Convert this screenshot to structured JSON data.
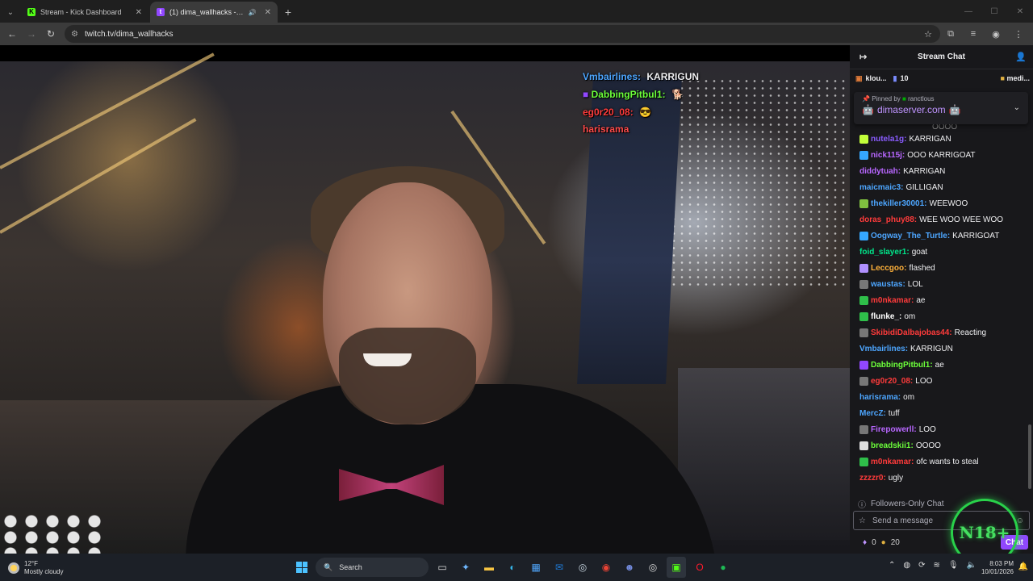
{
  "browser": {
    "tabs": [
      {
        "title": "Stream - Kick Dashboard",
        "active": false,
        "favicon": "kick-icon",
        "favicon_color": "#53fc18"
      },
      {
        "title": "(1) dima_wallhacks - Twitch",
        "active": true,
        "favicon": "twitch-icon",
        "favicon_color": "#9147ff"
      }
    ],
    "url": "twitch.tv/dima_wallhacks"
  },
  "overlay_chat": [
    {
      "user": "Vmbairlines:",
      "text": "KARRIGUN",
      "color": "#4da6ff"
    },
    {
      "user": "DabbingPitbul1:",
      "text": "",
      "color": "#6cff3a"
    },
    {
      "user": "eg0r20_08:",
      "text": "",
      "color": "#ff3b3b"
    },
    {
      "user": "harisrama",
      "text": "",
      "color": "#ff4a4a"
    }
  ],
  "chat": {
    "title": "Stream Chat",
    "leaderboard": {
      "user": "klou...",
      "count": "10",
      "right": "medi..."
    },
    "pinned": {
      "by_label": "Pinned by",
      "by_user": "ranctlous",
      "message": "dimaserver.com"
    },
    "partial_top": "OOOO",
    "messages": [
      {
        "user": "nutela1g:",
        "text": "KARRIGAN",
        "color": "#8a5cff",
        "badge": "#c3ff3a"
      },
      {
        "user": "nick115j:",
        "text": "OOO KARRIGOAT",
        "color": "#b867ff",
        "badge": "#35a7ff"
      },
      {
        "user": "diddytuah:",
        "text": "KARRIGAN",
        "color": "#b866ff",
        "badge": ""
      },
      {
        "user": "maicmaic3:",
        "text": "GILLIGAN",
        "color": "#4da6ff",
        "badge": ""
      },
      {
        "user": "thekiller30001:",
        "text": "WEEWOO",
        "color": "#4da6ff",
        "badge": "#7fbf3f"
      },
      {
        "user": "doras_phuy88:",
        "text": "WEE WOO WEE WOO",
        "color": "#ff3b3b",
        "badge": ""
      },
      {
        "user": "Oogway_The_Turtle:",
        "text": "KARRIGOAT",
        "color": "#4da6ff",
        "badge": "#35a7ff"
      },
      {
        "user": "foid_slayer1:",
        "text": "goat",
        "color": "#00e68a",
        "badge": ""
      },
      {
        "user": "Leccgoo:",
        "text": "flashed",
        "color": "#ffb13a",
        "badge": "#b090ff"
      },
      {
        "user": "waustas:",
        "text": "LOL",
        "color": "#4da6ff",
        "badge": "#777"
      },
      {
        "user": "m0nkamar:",
        "text": "ae",
        "color": "#ff3b3b",
        "badge": "#2fbf4a"
      },
      {
        "user": "flunke_:",
        "text": "om",
        "color": "#ffffff",
        "badge": "#2fbf4a"
      },
      {
        "user": "SkibidiDalbajobas44:",
        "text": "Reacting",
        "color": "#ff3b3b",
        "badge": "#777"
      },
      {
        "user": "Vmbairlines:",
        "text": "KARRIGUN",
        "color": "#4da6ff",
        "badge": ""
      },
      {
        "user": "DabbingPitbul1:",
        "text": "ae",
        "color": "#6cff3a",
        "badge": "#9147ff"
      },
      {
        "user": "eg0r20_08:",
        "text": "LOO",
        "color": "#ff3b3b",
        "badge": "#777"
      },
      {
        "user": "harisrama:",
        "text": "om",
        "color": "#4da6ff",
        "badge": ""
      },
      {
        "user": "MercZ:",
        "text": "tuff",
        "color": "#4da6ff",
        "badge": ""
      },
      {
        "user": "Firepowerll:",
        "text": "LOO",
        "color": "#b867ff",
        "badge": "#777"
      },
      {
        "user": "breadskii1:",
        "text": "OOOO",
        "color": "#6cff3a",
        "badge": "#ddd"
      },
      {
        "user": "m0nkamar:",
        "text": "ofc wants to steal",
        "color": "#ff3b3b",
        "badge": "#2fbf4a"
      },
      {
        "user": "zzzzr0:",
        "text": "ugly",
        "color": "#ff3b3b",
        "badge": ""
      }
    ],
    "followers_only": "Followers-Only Chat",
    "input_placeholder": "Send a message",
    "points_a": "0",
    "points_b": "20",
    "chat_button": "Chat"
  },
  "n18_logo": "N18+",
  "taskbar": {
    "weather_temp": "12°F",
    "weather_desc": "Mostly cloudy",
    "search_label": "Search",
    "time": "8:03 PM",
    "date": "10/01/2026"
  }
}
